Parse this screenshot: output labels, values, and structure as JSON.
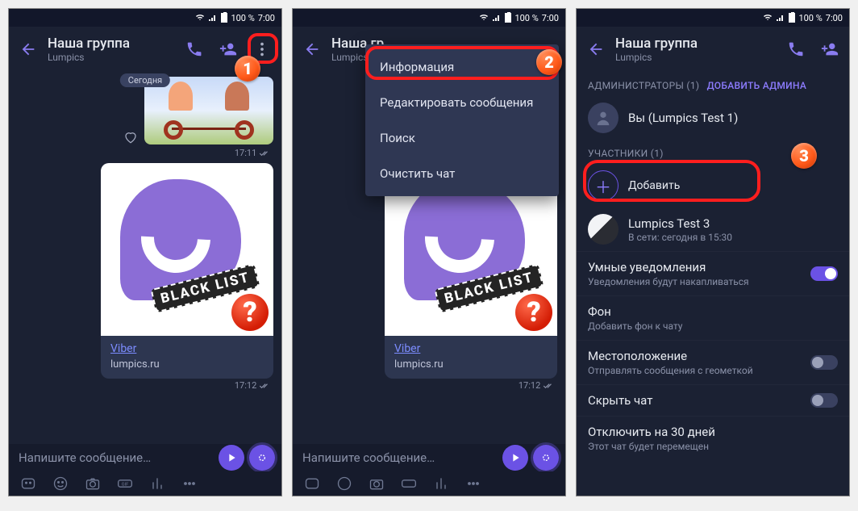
{
  "status": {
    "battery_pct": "100 %",
    "time": "7:00"
  },
  "header": {
    "title": "Наша группа",
    "title_clipped": "Наша гр",
    "subtitle": "Lumpics"
  },
  "chat": {
    "date_chip": "Сегодня",
    "time1": "17:11",
    "time2": "17:12",
    "link_title": "Viber",
    "link_site": "lumpics.ru",
    "blacklist": "BLACK LIST",
    "qmark": "?"
  },
  "composer": {
    "placeholder": "Напишите сообщение…"
  },
  "menu": {
    "info": "Информация",
    "edit": "Редактировать сообщения",
    "search": "Поиск",
    "clear": "Очистить чат"
  },
  "info": {
    "admins_hdr": "АДМИНИСТРАТОРЫ (1)",
    "add_admin": "ДОБАВИТЬ АДМИНА",
    "you": "Вы (Lumpics Test 1)",
    "members_hdr": "УЧАСТНИКИ (1)",
    "add": "Добавить",
    "member2": "Lumpics Test 3",
    "member2_sub": "В сети: сегодня в 15:30",
    "smart_t": "Умные уведомления",
    "smart_s": "Уведомления будут накапливаться",
    "bg_t": "Фон",
    "bg_s": "Добавить фон к чату",
    "loc_t": "Местоположение",
    "loc_s": "Отправлять сообщения с геометкой",
    "hide": "Скрыть чат",
    "mute_t": "Отключить на 30 дней",
    "mute_s": "Этот чат будет перемещен"
  },
  "badges": {
    "b1": "1",
    "b2": "2",
    "b3": "3"
  }
}
